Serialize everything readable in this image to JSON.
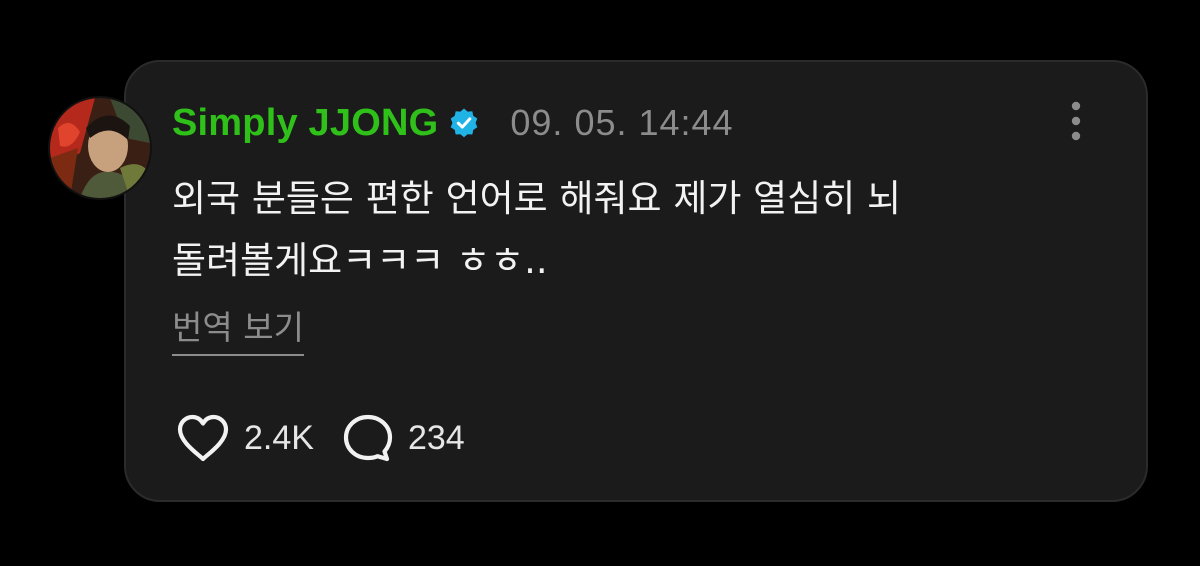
{
  "post": {
    "username": "Simply JJONG",
    "timestamp": "09. 05. 14:44",
    "text_lines": [
      "외국 분들은 편한 언어로 해줘요 제가 열심히 뇌",
      "돌려볼게요ㅋㅋㅋ  ㅎㅎ.."
    ],
    "translate_label": "번역 보기",
    "likes": "2.4K",
    "comments": "234"
  },
  "icons": {
    "verified": "verified-badge-icon",
    "more": "more-vertical-icon",
    "like": "heart-icon",
    "comment": "speech-bubble-icon"
  },
  "colors": {
    "background": "#000000",
    "card": "#1b1b1b",
    "username": "#2fc11a",
    "verified": "#1fb3e6",
    "muted": "#8c8c8c",
    "text": "#f2f2f2"
  }
}
